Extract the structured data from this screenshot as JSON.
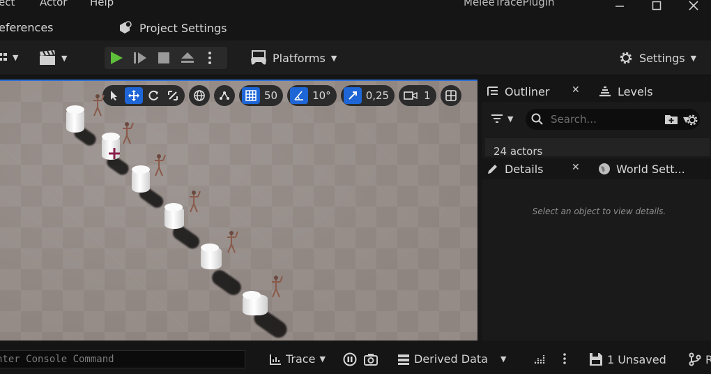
{
  "menu": {
    "items": [
      "ect",
      "Actor",
      "Help"
    ],
    "window_title": "MeleeTracePlugin"
  },
  "window_controls": [
    "minimize-icon",
    "maximize-icon",
    "close-icon"
  ],
  "secondary_menu": {
    "references": "eferences",
    "project_settings": "Project Settings"
  },
  "toolbar": {
    "platforms": "Platforms",
    "settings": "Settings",
    "play_color": "#5ebf3a"
  },
  "viewport": {
    "grid_snap": "50",
    "angle_snap": "10°",
    "scale_snap": "0,25",
    "camera_speed": "1",
    "active_color": "#1e66d6"
  },
  "outliner": {
    "tab_label": "Outliner",
    "levels_label": "Levels",
    "search_placeholder": "Search...",
    "actor_count": "24 actors"
  },
  "details": {
    "tab_label": "Details",
    "world_settings_label": "World Sett...",
    "empty_message": "Select an object to view details."
  },
  "statusbar": {
    "console_placeholder": "nter Console Command",
    "trace": "Trace",
    "derived_data": "Derived Data",
    "unsaved": "1 Unsaved",
    "revision": "R"
  }
}
